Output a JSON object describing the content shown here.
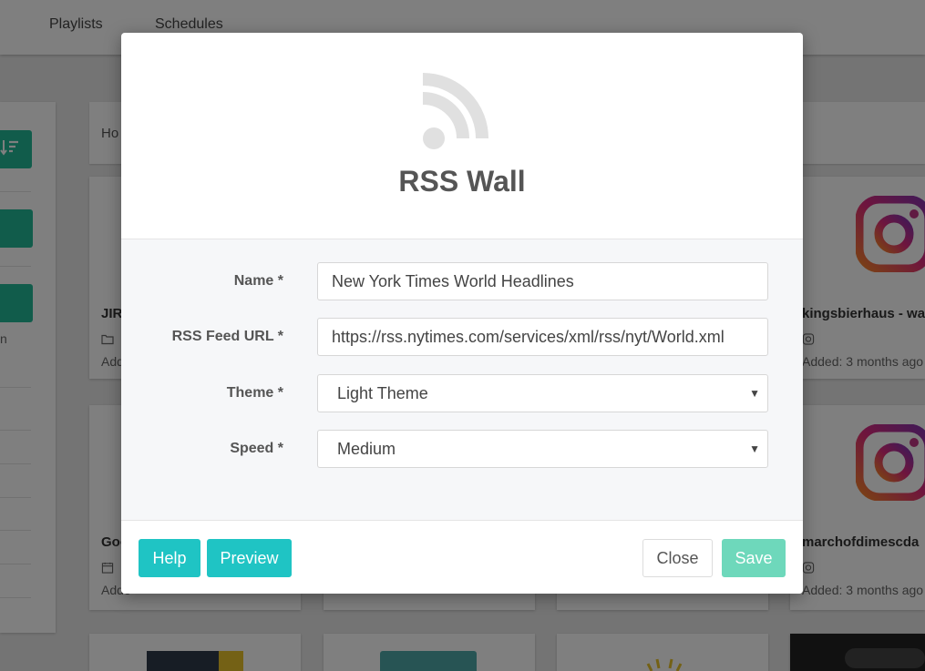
{
  "nav": {
    "playlists": "Playlists",
    "schedules": "Schedules"
  },
  "breadcrumb": {
    "text": "Ho"
  },
  "cards": [
    {
      "title": "JIR",
      "meta": "Add"
    },
    {
      "title": "kingsbierhaus - wa",
      "meta": "Added: 3 months ago"
    },
    {
      "title": "Goo",
      "meta": "Adde"
    },
    {
      "title": "marchofdimescda",
      "meta": "Added: 3 months ago"
    }
  ],
  "left_panel": {
    "fragment": "n"
  },
  "modal": {
    "title": "RSS Wall",
    "icon": "rss-icon",
    "fields": [
      {
        "label": "Name *",
        "value": "New York Times World Headlines"
      },
      {
        "label": "RSS Feed URL *",
        "value": "https://rss.nytimes.com/services/xml/rss/nyt/World.xml"
      },
      {
        "label": "Theme *",
        "value": "Light Theme"
      },
      {
        "label": "Speed *",
        "value": "Medium"
      }
    ],
    "buttons": {
      "help": "Help",
      "preview": "Preview",
      "close": "Close",
      "save": "Save"
    }
  },
  "colors": {
    "teal": "#1fc4c4",
    "save": "#6ed8bb",
    "green": "#22b896",
    "instagram_pink": "#d6297f",
    "instagram_orange": "#f58529"
  }
}
